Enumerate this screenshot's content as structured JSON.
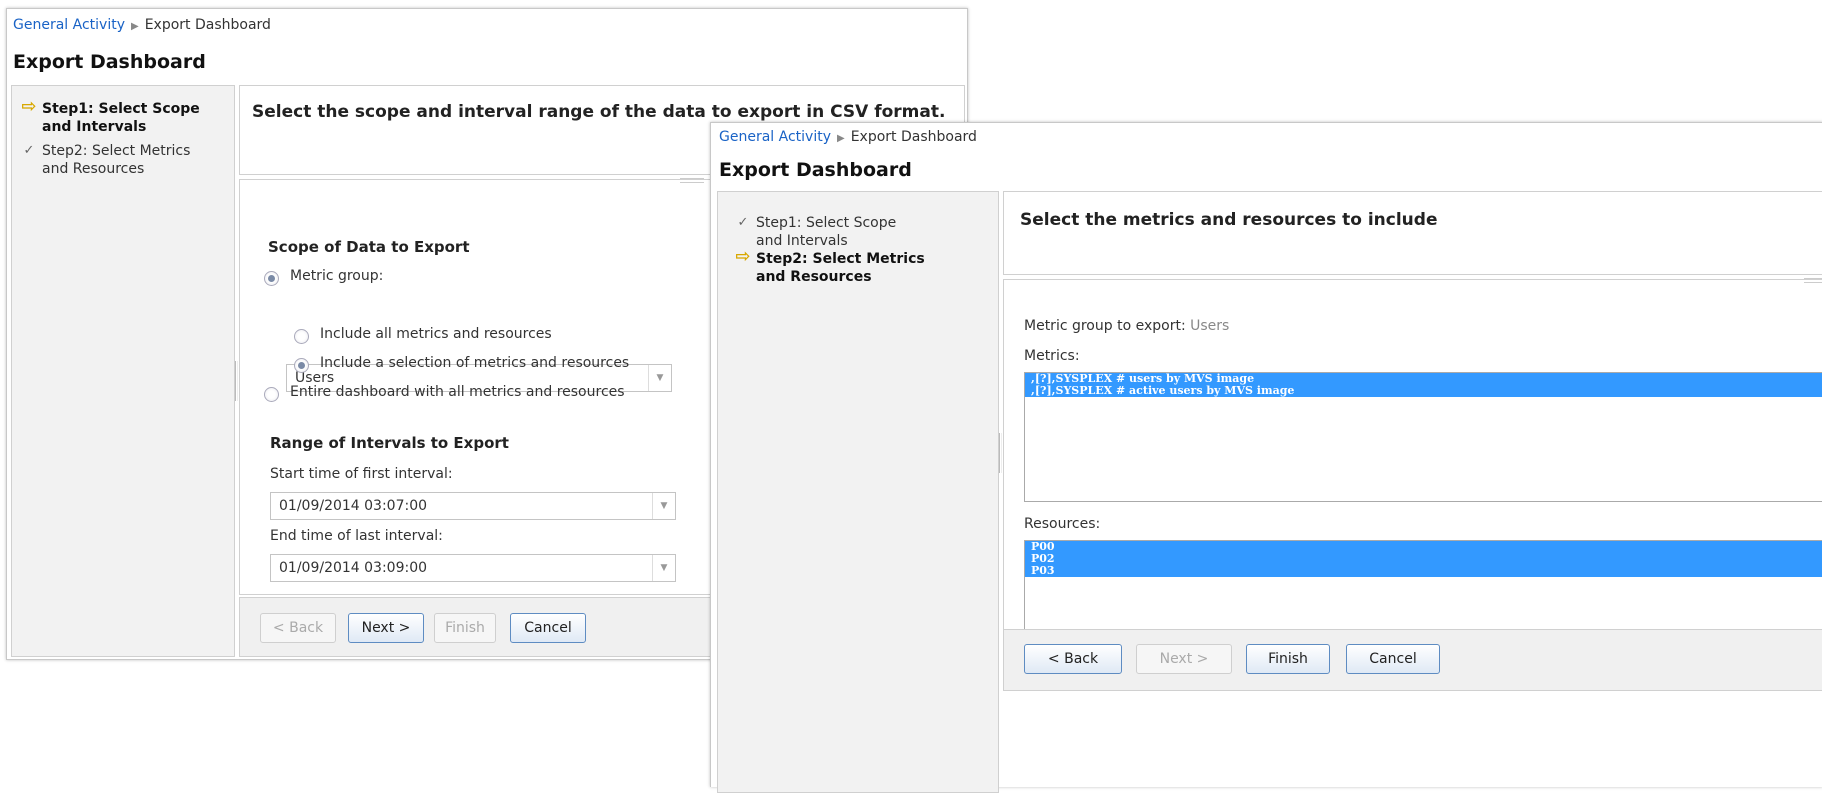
{
  "step1_panel": {
    "breadcrumb": {
      "parent": "General Activity",
      "current": "Export Dashboard"
    },
    "title": "Export Dashboard",
    "steps": [
      {
        "label_line1": "Step1: Select Scope",
        "label_line2": "and Intervals",
        "active": true
      },
      {
        "label_line1": "Step2: Select Metrics",
        "label_line2": "and Resources",
        "active": false
      }
    ],
    "header": "Select the scope and interval range of the data to export in CSV format.",
    "scope": {
      "heading": "Scope of Data to Export",
      "metric_group_label": "Metric group:",
      "metric_group_value": "Users",
      "opt_all": "Include all metrics and resources",
      "opt_selection": "Include a selection of metrics and resources",
      "opt_entire": "Entire dashboard with all metrics and resources"
    },
    "range": {
      "heading": "Range of Intervals to Export",
      "start_label": "Start time of first interval:",
      "start_value": "01/09/2014 03:07:00",
      "end_label": "End time of last interval:",
      "end_value": "01/09/2014 03:09:00"
    },
    "buttons": {
      "back": "< Back",
      "next": "Next >",
      "finish": "Finish",
      "cancel": "Cancel"
    }
  },
  "step2_panel": {
    "breadcrumb": {
      "parent": "General Activity",
      "current": "Export Dashboard"
    },
    "title": "Export Dashboard",
    "steps": [
      {
        "label_line1": "Step1: Select Scope",
        "label_line2": "and Intervals",
        "active": false
      },
      {
        "label_line1": "Step2: Select Metrics",
        "label_line2": "and Resources",
        "active": true
      }
    ],
    "header": "Select the metrics and resources to include",
    "metric_group_label": "Metric group to export:",
    "metric_group_value": "Users",
    "metrics_label": "Metrics:",
    "metrics": [
      ",[?],SYSPLEX # users by MVS image",
      ",[?],SYSPLEX # active users by MVS image"
    ],
    "resources_label": "Resources:",
    "resources": [
      "P00",
      "P02",
      "P03"
    ],
    "buttons": {
      "back": "< Back",
      "next": "Next >",
      "finish": "Finish",
      "cancel": "Cancel"
    }
  },
  "colors": {
    "link": "#1a63c6",
    "step_arrow": "#d8a800",
    "selection": "#3399ff",
    "button_border": "#5e8cc2"
  },
  "icons": {
    "breadcrumb_separator": "triangle-right-icon",
    "active_step": "arrow-right-icon",
    "completed_step": "checkmark-icon",
    "dropdown": "chevron-down-icon"
  }
}
